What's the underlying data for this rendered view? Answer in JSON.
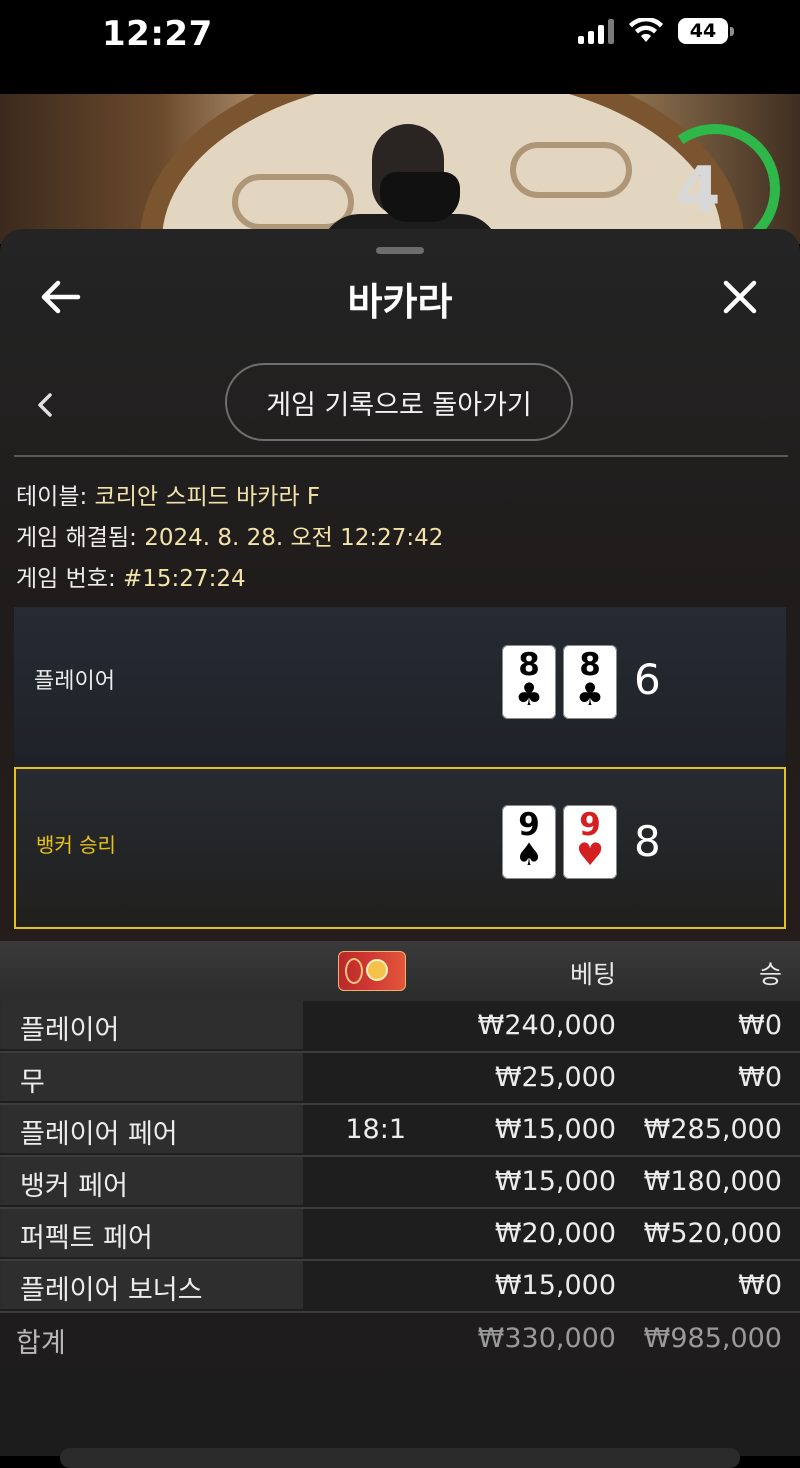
{
  "status_bar": {
    "time": "12:27",
    "battery": "44"
  },
  "video": {
    "timer": "4"
  },
  "header": {
    "title": "바카라"
  },
  "back_to_history_label": "게임 기록으로 돌아가기",
  "info": {
    "table_label": "테이블:",
    "table_value": "코리안 스피드 바카라 F",
    "resolved_label": "게임 해결됨:",
    "resolved_value": "2024. 8. 28. 오전 12:27:42",
    "game_no_label": "게임 번호:",
    "game_no_value": "#15:27:24"
  },
  "results": {
    "player": {
      "label": "플레이어",
      "cards": [
        {
          "rank": "8",
          "suit": "♣"
        },
        {
          "rank": "8",
          "suit": "♣"
        }
      ],
      "score": "6"
    },
    "banker": {
      "label": "뱅커 승리",
      "cards": [
        {
          "rank": "9",
          "suit": "♠"
        },
        {
          "rank": "9",
          "suit": "♥"
        }
      ],
      "score": "8"
    }
  },
  "bets_table": {
    "headers": {
      "bet": "베팅",
      "win": "승"
    },
    "rows": [
      {
        "name": "플레이어",
        "odds": "",
        "bet": "₩240,000",
        "win": "₩0"
      },
      {
        "name": "무",
        "odds": "",
        "bet": "₩25,000",
        "win": "₩0"
      },
      {
        "name": "플레이어 페어",
        "odds": "18:1",
        "bet": "₩15,000",
        "win": "₩285,000"
      },
      {
        "name": "뱅커 페어",
        "odds": "",
        "bet": "₩15,000",
        "win": "₩180,000"
      },
      {
        "name": "퍼펙트 페어",
        "odds": "",
        "bet": "₩20,000",
        "win": "₩520,000"
      },
      {
        "name": "플레이어 보너스",
        "odds": "",
        "bet": "₩15,000",
        "win": "₩0"
      }
    ],
    "total": {
      "name": "합계",
      "bet": "₩330,000",
      "win": "₩985,000"
    }
  },
  "colors": {
    "accent_gold": "#e3c21e",
    "info_value": "#f2e3a8",
    "timer_green": "#2eb84a",
    "heart_red": "#d42020"
  }
}
